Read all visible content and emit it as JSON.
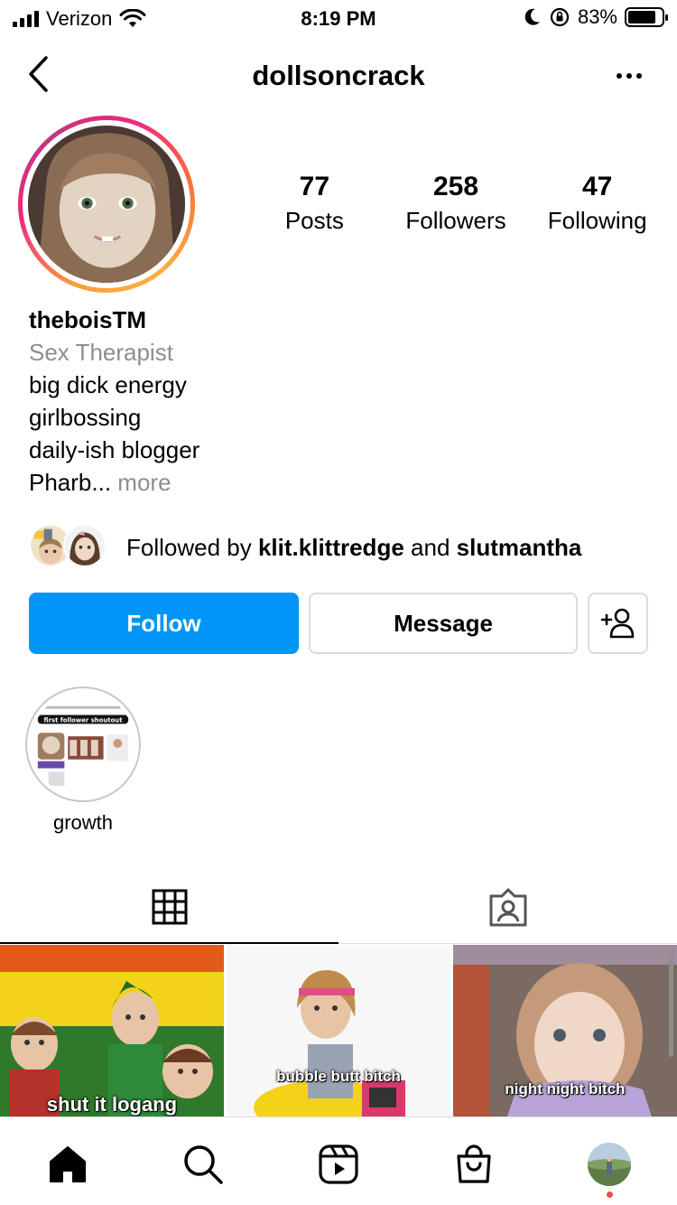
{
  "status_bar": {
    "carrier": "Verizon",
    "time": "8:19 PM",
    "battery_percent": "83%",
    "battery_level": 0.83
  },
  "header": {
    "username": "dollsoncrack",
    "back_icon": "chevron-left-icon",
    "more_icon": "ellipsis-icon"
  },
  "profile": {
    "stats": [
      {
        "value": "77",
        "label": "Posts"
      },
      {
        "value": "258",
        "label": "Followers"
      },
      {
        "value": "47",
        "label": "Following"
      }
    ],
    "display_name": "theboisTM",
    "category": "Sex Therapist",
    "bio_lines": [
      "big dick energy",
      "girlbossing",
      "daily-ish blogger"
    ],
    "bio_truncated": "Pharb...",
    "more_label": "more"
  },
  "followed_by": {
    "prefix": "Followed by",
    "user1": "klit.klittredge",
    "conjunction": "and",
    "user2": "slutmantha"
  },
  "actions": {
    "follow_label": "Follow",
    "message_label": "Message",
    "add_icon": "add-person-icon"
  },
  "highlights": [
    {
      "label": "growth",
      "cover_text": "first follower shoutout"
    }
  ],
  "tabs": [
    {
      "icon": "grid-icon",
      "active": true
    },
    {
      "icon": "tagged-icon",
      "active": false
    }
  ],
  "posts": [
    {
      "caption": "shut it logang"
    },
    {
      "caption": "bubble butt bitch"
    },
    {
      "caption": "night night bitch"
    }
  ],
  "bottom_nav": [
    {
      "icon": "home-icon"
    },
    {
      "icon": "search-icon"
    },
    {
      "icon": "reels-icon"
    },
    {
      "icon": "shop-icon"
    },
    {
      "icon": "profile-avatar"
    }
  ],
  "colors": {
    "accent": "#0095f6",
    "muted_text": "#8e8e8e",
    "border": "#dbdbdb",
    "notification_dot": "#ed4956"
  }
}
